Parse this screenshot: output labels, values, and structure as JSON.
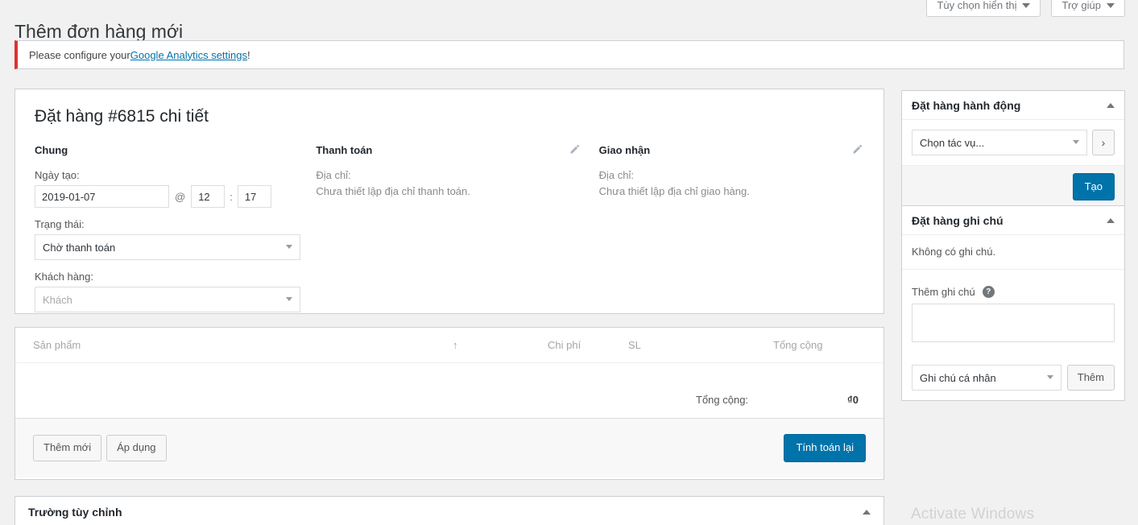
{
  "topbar": {
    "screen_options_label": "Tùy chọn hiển thị",
    "help_label": "Trợ giúp"
  },
  "page": {
    "title": "Thêm đơn hàng mới"
  },
  "notice": {
    "text_before": "Please configure your ",
    "link_text": "Google Analytics settings",
    "text_after": "!"
  },
  "order": {
    "heading": "Đặt hàng #6815 chi tiết",
    "general": {
      "column_title": "Chung",
      "date_label": "Ngày tạo:",
      "date_value": "2019-01-07",
      "at_symbol": "@",
      "hour_value": "12",
      "colon": ":",
      "minute_value": "17",
      "status_label": "Trạng thái:",
      "status_value": "Chờ thanh toán",
      "customer_label": "Khách hàng:",
      "customer_placeholder": "Khách"
    },
    "billing": {
      "column_title": "Thanh toán",
      "address_label": "Địa chỉ:",
      "address_value": "Chưa thiết lập địa chỉ thanh toán."
    },
    "shipping": {
      "column_title": "Giao nhận",
      "address_label": "Địa chỉ:",
      "address_value": "Chưa thiết lập địa chỉ giao hàng."
    }
  },
  "items": {
    "columns": {
      "product": "Sản phẩm",
      "sort": "↑",
      "cost": "Chi phí",
      "qty": "SL",
      "total": "Tổng cộng"
    },
    "total_label": "Tổng cộng:",
    "total_value": "₫0",
    "add_item_label": "Thêm mới",
    "apply_label": "Áp dụng",
    "recalculate_label": "Tính toán lại"
  },
  "custom_fields": {
    "title": "Trường tùy chỉnh"
  },
  "sidebar": {
    "actions": {
      "title": "Đặt hàng hành động",
      "select_value": "Chọn tác vụ...",
      "go_label": "›",
      "create_label": "Tạo"
    },
    "notes": {
      "title": "Đặt hàng ghi chú",
      "empty_text": "Không có ghi chú.",
      "add_label": "Thêm ghi chú",
      "help_glyph": "?",
      "textarea_value": "",
      "note_type_value": "Ghi chú cá nhân",
      "add_button_label": "Thêm"
    }
  },
  "watermark": {
    "text": "Activate Windows"
  },
  "colors": {
    "accent": "#0073aa",
    "notice_border": "#dc3232",
    "background": "#f1f1f1",
    "panel_border": "#ccd0d4"
  }
}
